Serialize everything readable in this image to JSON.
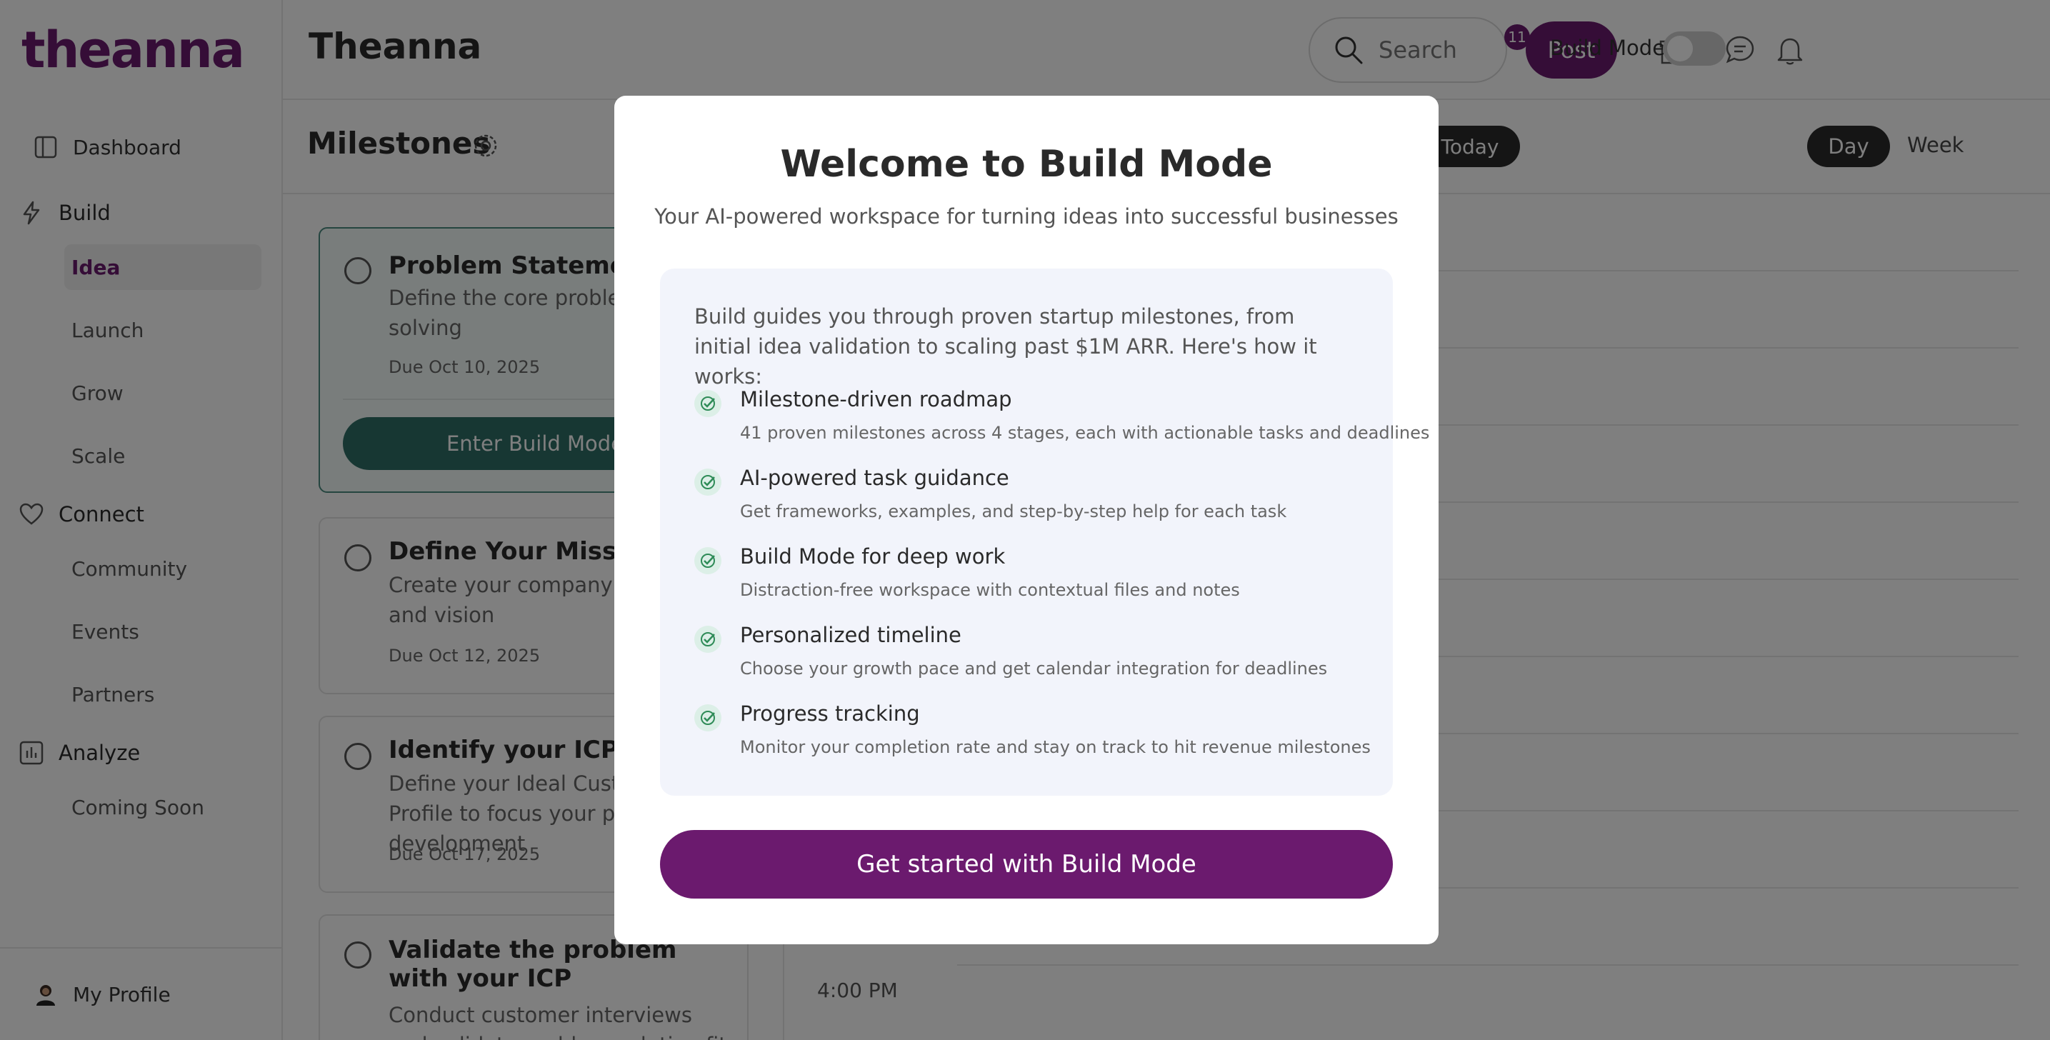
{
  "app": {
    "logo": "theanna",
    "header_title": "Theanna"
  },
  "sidebar": {
    "dashboard": "Dashboard",
    "sections": [
      {
        "label": "Build",
        "items": [
          "Idea",
          "Launch",
          "Grow",
          "Scale"
        ],
        "active": "Idea"
      },
      {
        "label": "Connect",
        "items": [
          "Community",
          "Events",
          "Partners"
        ]
      },
      {
        "label": "Analyze",
        "items": [
          "Coming Soon"
        ]
      }
    ],
    "profile": "My Profile"
  },
  "header": {
    "search_placeholder": "Search",
    "post_label": "Post",
    "notification_count": "11",
    "build_mode_label": "Build Mode",
    "build_mode_on": false
  },
  "milestones": {
    "title": "Milestones",
    "cards": [
      {
        "title": "Problem Statement",
        "desc": "Define the core problem you're solving",
        "due": "Due Oct 10, 2025",
        "action": "Enter Build Mode"
      },
      {
        "title": "Define Your Mission",
        "desc": "Create your company mission and vision",
        "due": "Due Oct 12, 2025"
      },
      {
        "title": "Identify your ICP",
        "desc": "Define your Ideal Customer Profile to focus your product development",
        "due": "Due Oct 17, 2025"
      },
      {
        "title": "Validate the problem with your ICP",
        "desc": "Conduct customer interviews and validate problem-solution fit"
      }
    ]
  },
  "calendar": {
    "today_label": "Today",
    "day_label": "Day",
    "week_label": "Week",
    "time_label": "4:00 PM"
  },
  "modal": {
    "title": "Welcome to Build Mode",
    "subtitle": "Your AI-powered workspace for turning ideas into successful businesses",
    "intro": "Build guides you through proven startup milestones, from initial idea validation to scaling past $1M ARR. Here's how it works:",
    "features": [
      {
        "title": "Milestone-driven roadmap",
        "desc": "41 proven milestones across 4 stages, each with actionable tasks and deadlines"
      },
      {
        "title": "AI-powered task guidance",
        "desc": "Get frameworks, examples, and step-by-step help for each task"
      },
      {
        "title": "Build Mode for deep work",
        "desc": "Distraction-free workspace with contextual files and notes"
      },
      {
        "title": "Personalized timeline",
        "desc": "Choose your growth pace and get calendar integration for deadlines"
      },
      {
        "title": "Progress tracking",
        "desc": "Monitor your completion rate and stay on track to hit revenue milestones"
      }
    ],
    "cta": "Get started with Build Mode"
  },
  "colors": {
    "brand": "#6b1a6e",
    "accent_green": "#2f6f66",
    "check_green": "#2e8b57"
  }
}
